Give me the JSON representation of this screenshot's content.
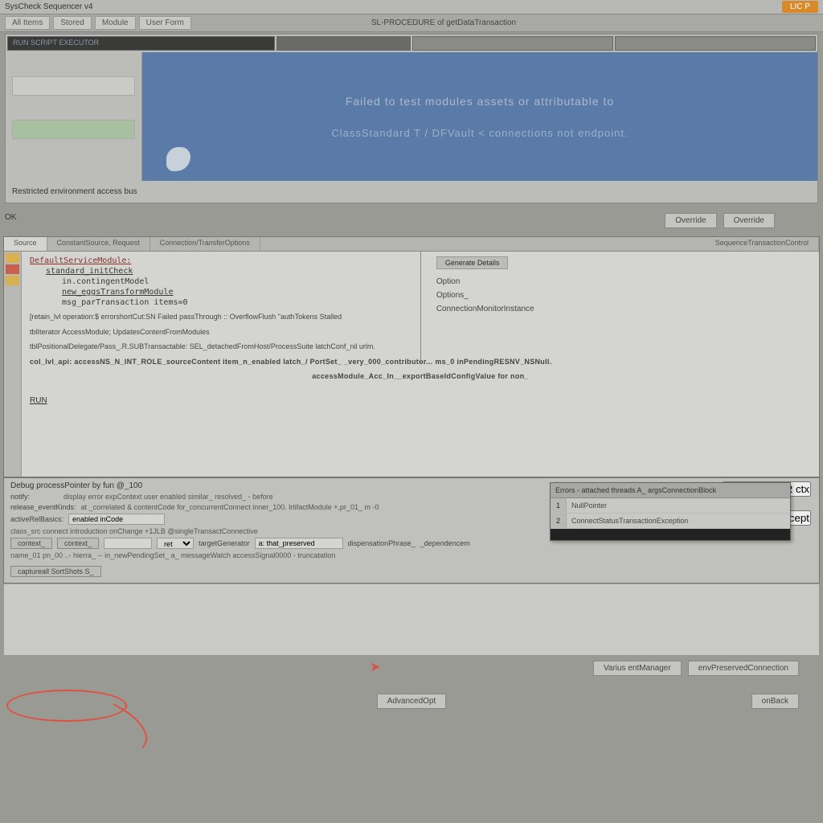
{
  "topbar": {
    "title": "SysCheck Sequencer v4",
    "badge": "LIC P"
  },
  "tabs": {
    "items": [
      "All Items",
      "Stored",
      "Module",
      "User Form"
    ],
    "heading": "SL-PROCEDURE of getDataTransaction"
  },
  "banner": {
    "titlebar_dark_label": "RUN SCRIPT EXECUTOR",
    "line1": "Failed to test modules assets or attributable to",
    "line2": "ClassStandard T / DFVault < connections not endpoint."
  },
  "win1_footer": "Restricted environment access bus",
  "row_label": "OK",
  "row_buttons": [
    "Override",
    "Override"
  ],
  "editor": {
    "tabs": [
      "Source",
      "ConstantSource, Request",
      "Connection/TransferOptions"
    ],
    "tab_right": "SequenceTransactionControl",
    "code": [
      "DefaultServiceModule:",
      "standard_initCheck",
      "  in.contingentModel",
      "  new_eggsTransformModule",
      "  msg_parTransaction items=0",
      "[retain_lvl operation:$  errorshortCut:SN Failed passThrough ::  OverflowFlush ''authTokens  Stalled",
      "tblIterator  AccessModule; UpdatesContentFromModules",
      "tblPositionalDelegate/Pass_.R.SUBTransactable:    SEL_detachedFromHost/ProcessSuite  latchConf_nil urlm.",
      "col_lvl_api: accessNS_N_INT_ROLE_sourceContent item_n_enabled latch_/ PortSet_  _very_000_contributor...  ms_0 inPendingRESNV_NSNull.",
      "                                                             accessModule_Acc_In__exportBaseIdConfigValue for non_",
      "RUN"
    ],
    "right_btn": "Generate Details",
    "right_labels": [
      "Option",
      "Options_",
      "ConnectionMonitorInstance"
    ]
  },
  "popup": {
    "title": "Errors - attached threads A_ argsConnectionBlock",
    "rows": [
      {
        "n": "1",
        "v": "NullPointer"
      },
      {
        "n": "2",
        "v": "ConnectStatusTransactionException"
      }
    ]
  },
  "form": {
    "title": "Debug  processPointer  by fun  @_100",
    "rows": [
      {
        "l": "notify:",
        "rest": "display error  expContext user  enabled  similar_  resolved_ - before"
      },
      {
        "l": "release_eventKinds:",
        "rest": "at  _correlated & contentCode for_concurrentConnect  inner_100. lrtifactModule    +,pr_01_ m -0"
      },
      {
        "l": "activeRelBasics:",
        "rest": "enabled inCode"
      },
      {
        "l": "class_src  connect  introduction  onChange  +1JLB    @singleTransactConnective"
      },
      {
        "l": "name_01  pn_00   ..-   hierra_  -- in_newPendingSet_ a_ messageWatch  accessSignal0000 - truncatation"
      }
    ],
    "right_btn": "ORIGINAL XR ctx",
    "right_btn2": "Accept",
    "fieldrow": {
      "labels": [
        "context_",
        "context_",
        "targetGenerator",
        "dispensationPhrase_"
      ],
      "input1": "",
      "select1": "ret_",
      "input2": "a: that_preserved",
      "trailing": "_dependencem"
    },
    "anno_target": "captureall  SortShots S_"
  },
  "lowfooter": {
    "btns": [
      "Varius entManager",
      "envPreservedConnection"
    ]
  },
  "footer": {
    "center": "AdvancedOpt",
    "right": "onBack"
  }
}
